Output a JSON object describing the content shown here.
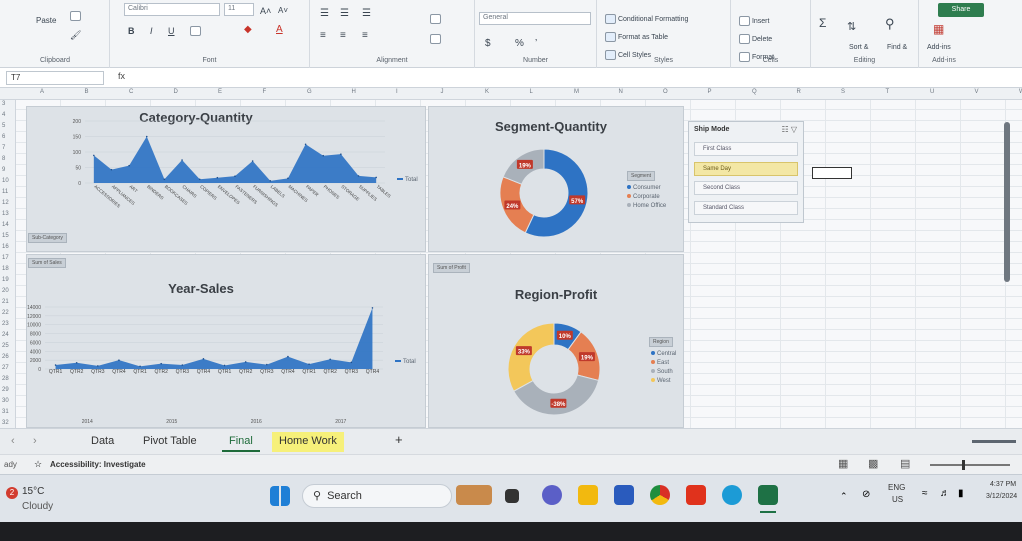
{
  "ribbon": {
    "clipboard": {
      "paste": "Paste",
      "label": "Clipboard"
    },
    "font": {
      "name": "Calibri",
      "size": "11",
      "grow": "A˄",
      "shrink": "A˅",
      "bold": "B",
      "italic": "I",
      "underline": "U",
      "label": "Font"
    },
    "alignment": {
      "label": "Alignment"
    },
    "number": {
      "format": "General",
      "currency": "$",
      "percent": "%",
      "comma": "’",
      "label": "Number"
    },
    "styles": {
      "conditional": "Conditional Formatting",
      "table": "Format as Table",
      "cell": "Cell Styles",
      "label": "Styles"
    },
    "cells": {
      "insert": "Insert",
      "delete": "Delete",
      "format": "Format",
      "label": "Cells"
    },
    "editing": {
      "sort": "Sort &",
      "sort2": "Filter",
      "find": "Find &",
      "find2": "Select",
      "label": "Editing"
    },
    "addins": {
      "btn": "Add-ins",
      "label": "Add-ins"
    },
    "share": "Share"
  },
  "formula_bar": {
    "name_box": "T7",
    "fx": "fx",
    "value": ""
  },
  "columns": [
    "A",
    "B",
    "C",
    "D",
    "E",
    "F",
    "G",
    "H",
    "I",
    "J",
    "K",
    "L",
    "M",
    "N",
    "O",
    "P",
    "Q",
    "R",
    "S",
    "T",
    "U",
    "V",
    "W"
  ],
  "rows": [
    "3",
    "4",
    "5",
    "6",
    "7",
    "8",
    "9",
    "10",
    "11",
    "12",
    "13",
    "14",
    "15",
    "16",
    "17",
    "18",
    "19",
    "20",
    "21",
    "22",
    "23",
    "24",
    "25",
    "26",
    "27",
    "28",
    "29",
    "30",
    "31",
    "32"
  ],
  "charts": {
    "category": {
      "title": "Category-Quantity",
      "filter": "Sub-Category",
      "legend": "Total"
    },
    "segment": {
      "title": "Segment-Quantity",
      "filter": "Segment",
      "legend": [
        "Consumer",
        "Corporate",
        "Home Office"
      ]
    },
    "year": {
      "title": "Year-Sales",
      "filter": "Sum of Sales",
      "legend": "Total"
    },
    "region": {
      "title": "Region-Profit",
      "filter": "Sum of Profit",
      "region_filter": "Region",
      "legend": [
        "Central",
        "East",
        "South",
        "West"
      ]
    }
  },
  "chart_data": [
    {
      "type": "area",
      "title": "Category-Quantity",
      "categories": [
        "ACCESSORIES",
        "APPLIANCES",
        "ART",
        "BINDERS",
        "BOOKCASES",
        "CHAIRS",
        "COPIERS",
        "ENVELOPES",
        "FASTENERS",
        "FURNISHINGS",
        "LABELS",
        "MACHINES",
        "PAPER",
        "PHONES",
        "STORAGE",
        "SUPPLIES",
        "TABLES"
      ],
      "values": [
        89,
        43,
        56,
        150,
        12,
        74,
        12,
        17,
        22,
        71,
        7,
        15,
        125,
        88,
        93,
        23,
        18
      ],
      "ylim": [
        0,
        200
      ],
      "yticks": [
        "200",
        "150",
        "100",
        "50",
        "0"
      ],
      "legend": "Total"
    },
    {
      "type": "pie",
      "title": "Segment-Quantity",
      "labels": [
        "Consumer",
        "Corporate",
        "Home Office"
      ],
      "values": [
        57,
        24,
        19
      ],
      "display": [
        "57%",
        "24%",
        "19%"
      ],
      "colors": [
        "#2e73c4",
        "#e57f52",
        "#a9b1ba"
      ]
    },
    {
      "type": "area",
      "title": "Year-Sales",
      "quarters": [
        "QTR1",
        "QTR2",
        "QTR3",
        "QTR4",
        "QTR1",
        "QTR2",
        "QTR3",
        "QTR4",
        "QTR1",
        "QTR2",
        "QTR3",
        "QTR4",
        "QTR1",
        "QTR2",
        "QTR3",
        "QTR4"
      ],
      "years": [
        "2014",
        "2015",
        "2016",
        "2017"
      ],
      "values": [
        900,
        1400,
        700,
        2000,
        600,
        1200,
        900,
        2300,
        800,
        1600,
        1000,
        2800,
        1100,
        2200,
        1500,
        13800
      ],
      "ylim": [
        0,
        14000
      ],
      "yticks": [
        "14000",
        "12000",
        "10000",
        "8000",
        "6000",
        "4000",
        "2000",
        "0"
      ],
      "legend": "Total"
    },
    {
      "type": "pie",
      "title": "Region-Profit",
      "labels": [
        "Central",
        "East",
        "South",
        "West"
      ],
      "values": [
        10,
        19,
        38,
        33
      ],
      "display": [
        "10%",
        "19%",
        "-38%",
        "33%"
      ],
      "colors": [
        "#2e73c4",
        "#e57f52",
        "#a9b1ba",
        "#f3c75a"
      ]
    }
  ],
  "slicer": {
    "title": "Ship Mode",
    "items": [
      "First Class",
      "Same Day",
      "Second Class",
      "Standard Class"
    ],
    "selected": "Same Day"
  },
  "tabs": [
    "Data",
    "Pivot Table",
    "Final",
    "Home Work"
  ],
  "active_tab": "Final",
  "status": {
    "left": "ady",
    "accessibility": "Accessibility: Investigate"
  },
  "taskbar": {
    "weather_temp": "15°C",
    "weather_desc": "Cloudy",
    "search": "Search",
    "lang": "ENG",
    "region": "US",
    "time": "4:37 PM",
    "date": "3/12/2024"
  }
}
